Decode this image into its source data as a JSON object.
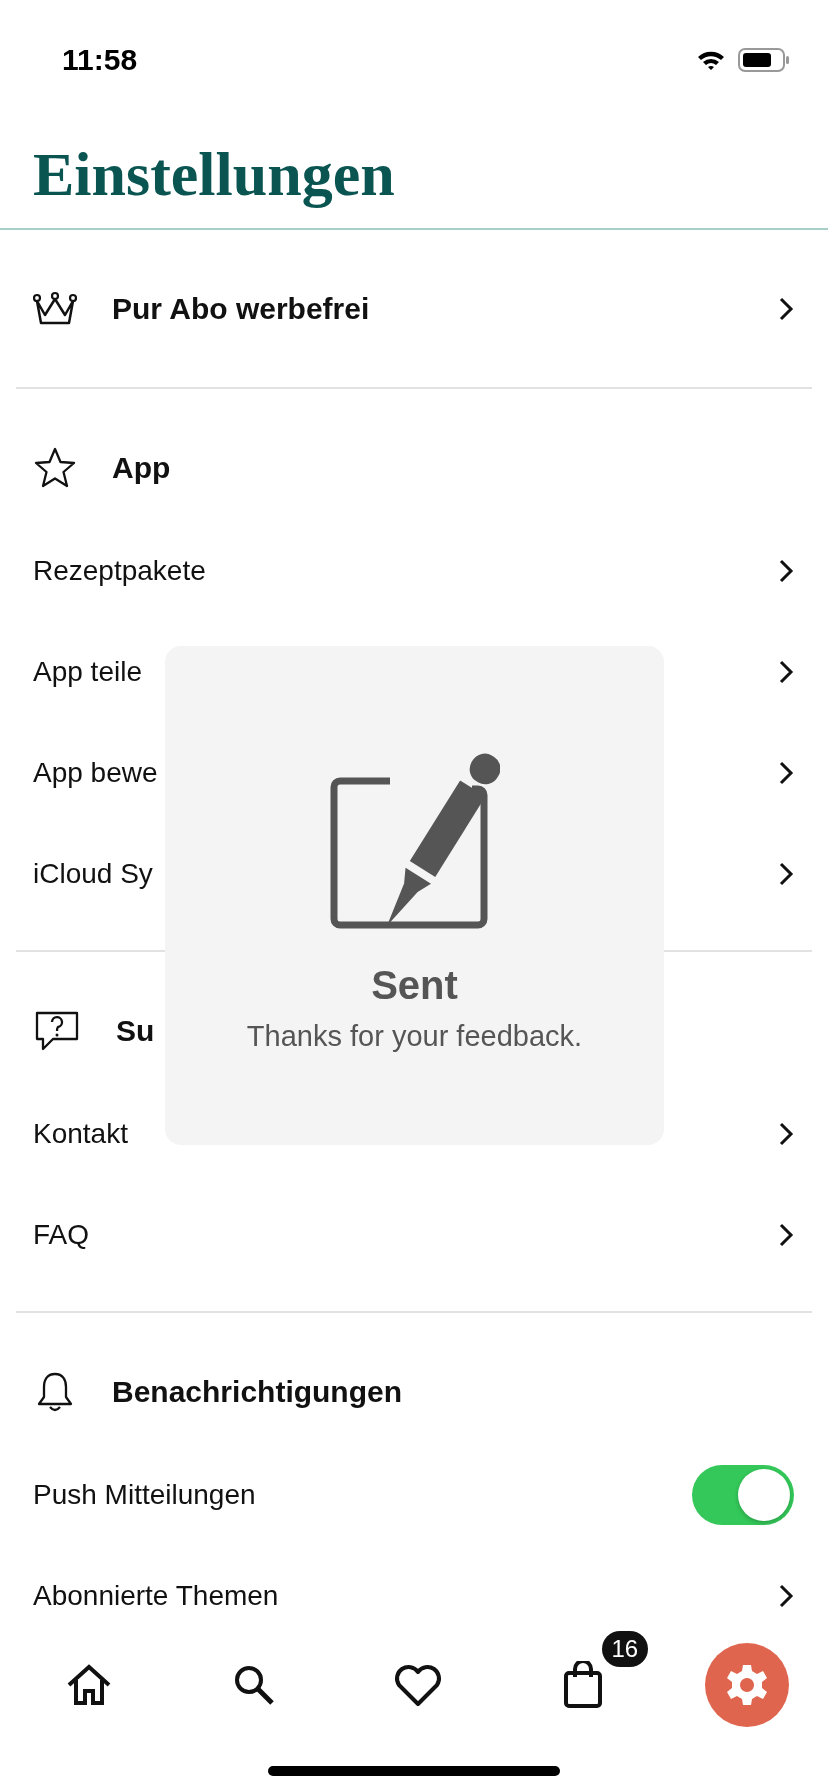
{
  "status_bar": {
    "time": "11:58"
  },
  "title": "Einstellungen",
  "sections": [
    {
      "header": {
        "label": "Pur Abo werbefrei",
        "kind": "link"
      }
    },
    {
      "header": {
        "label": "App",
        "kind": "plain"
      },
      "items": [
        {
          "label": "Rezeptpakete",
          "kind": "link"
        },
        {
          "label": "App teile",
          "kind": "link"
        },
        {
          "label": "App bewe",
          "kind": "link"
        },
        {
          "label": "iCloud Sy",
          "kind": "link"
        }
      ]
    },
    {
      "header": {
        "label": "Su",
        "kind": "plain"
      },
      "items": [
        {
          "label": "Kontakt",
          "kind": "link"
        },
        {
          "label": "FAQ",
          "kind": "link"
        }
      ]
    },
    {
      "header": {
        "label": "Benachrichtigungen",
        "kind": "plain"
      },
      "items": [
        {
          "label": "Push Mitteilungen",
          "kind": "toggle",
          "on": true
        },
        {
          "label": "Abonnierte Themen",
          "kind": "link"
        }
      ]
    }
  ],
  "toast": {
    "title": "Sent",
    "message": "Thanks for your feedback."
  },
  "tab_bar": [
    {
      "selected": false
    },
    {
      "selected": false
    },
    {
      "selected": false
    },
    {
      "selected": false,
      "badge": "16"
    },
    {
      "selected": true
    }
  ]
}
